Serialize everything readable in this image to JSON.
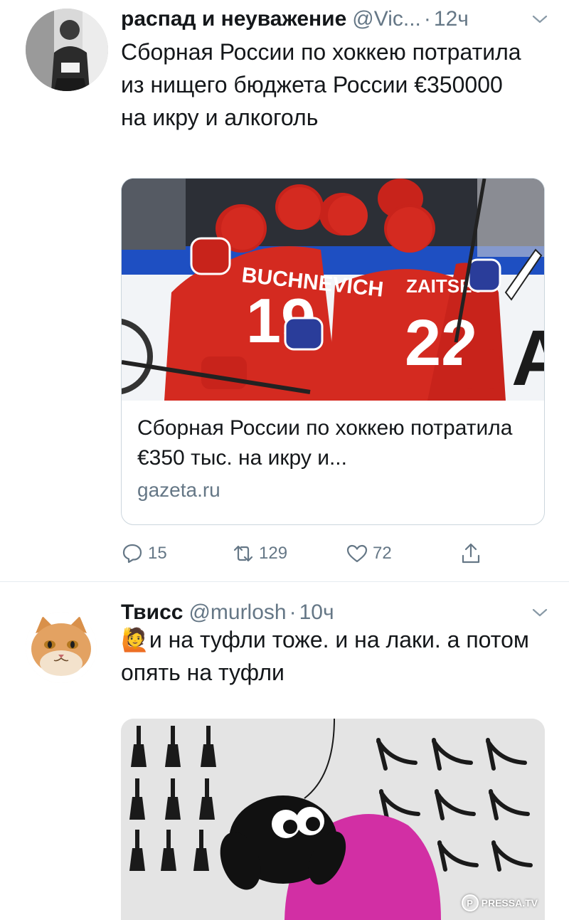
{
  "tweets": [
    {
      "name": "распад и неуважение",
      "handle": "@Vic...",
      "dot": "·",
      "time": "12ч",
      "text": "Сборная России по хоккею потратила из нищего бюджета России €350000 на икру и алкоголь",
      "card": {
        "title": "Сборная России по хоккею потратила €350 тыс. на икру и...",
        "domain": "gazeta.ru",
        "image_jersey_1": "BUCHNEVICH",
        "image_number_1": "19",
        "image_jersey_2": "ZAITSEV",
        "image_number_2": "22"
      },
      "actions": {
        "reply_count": "15",
        "retweet_count": "129",
        "like_count": "72"
      }
    },
    {
      "name": "Твисс",
      "handle": "@murlosh",
      "dot": "·",
      "time": "10ч",
      "emoji": "🙋",
      "text": "и на туфли тоже. и на лаки. а потом опять на туфли"
    }
  ],
  "watermark": {
    "letter": "P",
    "text": "PRESSA.TV"
  },
  "colors": {
    "text_primary": "#14171a",
    "text_secondary": "#657786",
    "border": "#ccd6dd",
    "jersey_red": "#d42a20",
    "rink_blue": "#1e4fc2",
    "sheep_pink": "#d22fa4"
  },
  "icons": [
    "avatar-photo",
    "chevron-down-icon",
    "reply-icon",
    "retweet-icon",
    "like-icon",
    "share-icon",
    "cat-avatar",
    "nail-polish-icon",
    "high-heel-icon",
    "sheep-illustration"
  ]
}
